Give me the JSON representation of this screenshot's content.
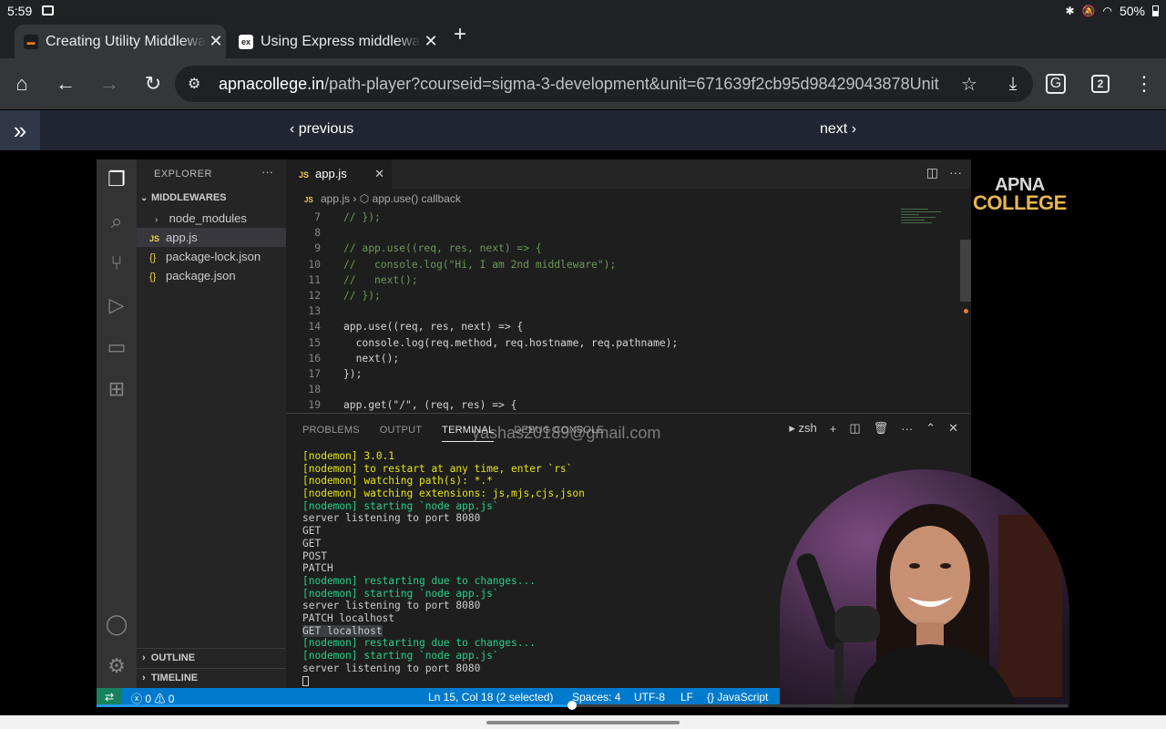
{
  "status_bar": {
    "time": "5:59",
    "battery": "50%"
  },
  "tabs": [
    {
      "title": "Creating Utility Middleware",
      "favicon": "apna-college-favicon",
      "active": true
    },
    {
      "title": "Using Express middleware",
      "favicon_text": "ex",
      "active": false
    }
  ],
  "toolbar": {
    "url_host": "apnacollege.in",
    "url_rest": "/path-player?courseid=sigma-3-development&unit=671639f2cb95d98429043878Unit",
    "tab_count": "2"
  },
  "page_nav": {
    "previous": "‹ previous",
    "next": "next ›"
  },
  "vscode": {
    "explorer": {
      "title": "EXPLORER",
      "folder": "MIDDLEWARES",
      "items": [
        {
          "label": "node_modules",
          "type": "folder"
        },
        {
          "label": "app.js",
          "type": "js",
          "selected": true
        },
        {
          "label": "package-lock.json",
          "type": "json"
        },
        {
          "label": "package.json",
          "type": "json"
        }
      ],
      "outline": "OUTLINE",
      "timeline": "TIMELINE"
    },
    "editor_tab": "app.js",
    "breadcrumb": {
      "file": "app.js",
      "symbol": "app.use() callback"
    },
    "code_lines": [
      {
        "n": "7",
        "text": "// });"
      },
      {
        "n": "8",
        "text": ""
      },
      {
        "n": "9",
        "text": "// app.use((req, res, next) => {"
      },
      {
        "n": "10",
        "text": "//   console.log(\"Hi, I am 2nd middleware\");"
      },
      {
        "n": "11",
        "text": "//   next();"
      },
      {
        "n": "12",
        "text": "// });"
      },
      {
        "n": "13",
        "text": ""
      },
      {
        "n": "14",
        "text": "app.use((req, res, next) => {"
      },
      {
        "n": "15",
        "text": "  console.log(req.method, req.hostname, req.pathname);"
      },
      {
        "n": "16",
        "text": "  next();"
      },
      {
        "n": "17",
        "text": "});"
      },
      {
        "n": "18",
        "text": ""
      },
      {
        "n": "19",
        "text": "app.get(\"/\", (req, res) => {"
      }
    ],
    "panel_tabs": [
      "PROBLEMS",
      "OUTPUT",
      "TERMINAL",
      "DEBUG CONSOLE"
    ],
    "shell": "zsh",
    "terminal_lines": [
      {
        "text": "[nodemon] 3.0.1",
        "color": "y"
      },
      {
        "text": "[nodemon] to restart at any time, enter `rs`",
        "color": "y"
      },
      {
        "text": "[nodemon] watching path(s): *.*",
        "color": "y"
      },
      {
        "text": "[nodemon] watching extensions: js,mjs,cjs,json",
        "color": "y"
      },
      {
        "text": "[nodemon] starting `node app.js`",
        "color": "g"
      },
      {
        "text": "server listening to port 8080",
        "color": "w"
      },
      {
        "text": "GET",
        "color": "w"
      },
      {
        "text": "GET",
        "color": "w"
      },
      {
        "text": "POST",
        "color": "w"
      },
      {
        "text": "PATCH",
        "color": "w"
      },
      {
        "text": "[nodemon] restarting due to changes...",
        "color": "g"
      },
      {
        "text": "[nodemon] starting `node app.js`",
        "color": "g"
      },
      {
        "text": "server listening to port 8080",
        "color": "w"
      },
      {
        "text": "PATCH localhost",
        "color": "w"
      },
      {
        "text": "GET localhost",
        "color": "sel"
      },
      {
        "text": "[nodemon] restarting due to changes...",
        "color": "g"
      },
      {
        "text": "[nodemon] starting `node app.js`",
        "color": "g"
      },
      {
        "text": "server listening to port 8080",
        "color": "w"
      }
    ],
    "watermark": "yashas20189@gmail.com",
    "status": {
      "problems": "0",
      "warnings": "0",
      "position": "Ln 15, Col 18 (2 selected)",
      "spaces": "Spaces: 4",
      "encoding": "UTF-8",
      "eol": "LF",
      "language": "JavaScript"
    }
  },
  "logo": {
    "line1": "APNA",
    "line2": "COLLEGE"
  },
  "video_progress": 0.49,
  "colors": {
    "accent": "#007acc",
    "terminal_yellow": "#e5e510",
    "terminal_green": "#23d18b"
  }
}
